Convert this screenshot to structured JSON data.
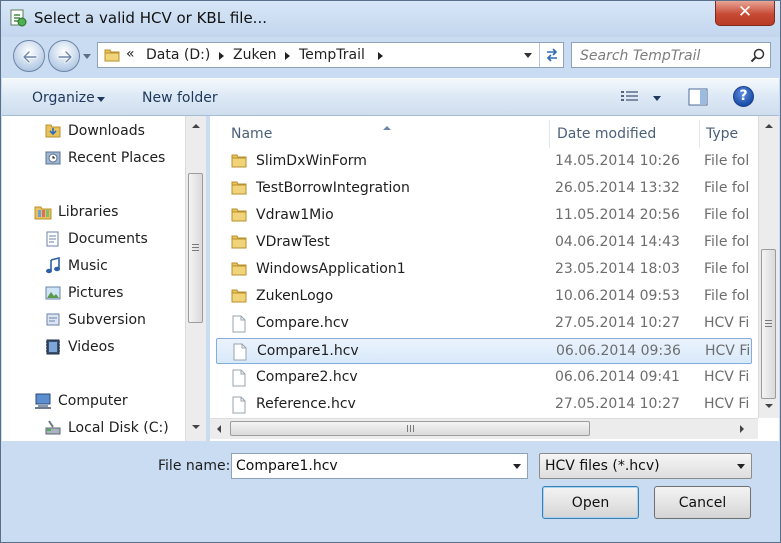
{
  "window": {
    "title": "Select a valid HCV or KBL file..."
  },
  "titlebar": {
    "close_label": "✕"
  },
  "address": {
    "overflow_marker": "«",
    "breadcrumbs": [
      "Data (D:)",
      "Zuken",
      "TempTrail"
    ]
  },
  "search": {
    "placeholder": "Search TempTrail"
  },
  "toolbar": {
    "organize_label": "Organize",
    "new_folder_label": "New folder",
    "help_label": "?"
  },
  "nav_pane": {
    "items": [
      {
        "label": "Downloads",
        "icon": "downloads-folder-icon"
      },
      {
        "label": "Recent Places",
        "icon": "recent-places-icon"
      },
      {
        "label": "Libraries",
        "icon": "libraries-icon"
      },
      {
        "label": "Documents",
        "icon": "documents-icon"
      },
      {
        "label": "Music",
        "icon": "music-icon"
      },
      {
        "label": "Pictures",
        "icon": "pictures-icon"
      },
      {
        "label": "Subversion",
        "icon": "subversion-icon"
      },
      {
        "label": "Videos",
        "icon": "videos-icon"
      },
      {
        "label": "Computer",
        "icon": "computer-icon"
      },
      {
        "label": "Local Disk (C:)",
        "icon": "local-disk-icon"
      }
    ]
  },
  "file_list": {
    "columns": [
      "Name",
      "Date modified",
      "Type"
    ],
    "rows": [
      {
        "name": "SlimDxWinForm",
        "date": "14.05.2014 10:26",
        "type": "File fol",
        "kind": "folder"
      },
      {
        "name": "TestBorrowIntegration",
        "date": "26.05.2014 13:32",
        "type": "File fol",
        "kind": "folder"
      },
      {
        "name": "Vdraw1Mio",
        "date": "11.05.2014 20:56",
        "type": "File fol",
        "kind": "folder"
      },
      {
        "name": "VDrawTest",
        "date": "04.06.2014 14:43",
        "type": "File fol",
        "kind": "folder"
      },
      {
        "name": "WindowsApplication1",
        "date": "23.05.2014 18:03",
        "type": "File fol",
        "kind": "folder"
      },
      {
        "name": "ZukenLogo",
        "date": "10.06.2014 09:53",
        "type": "File fol",
        "kind": "folder"
      },
      {
        "name": "Compare.hcv",
        "date": "27.05.2014 10:27",
        "type": "HCV Fi",
        "kind": "file"
      },
      {
        "name": "Compare1.hcv",
        "date": "06.06.2014 09:36",
        "type": "HCV Fi",
        "kind": "file",
        "selected": true
      },
      {
        "name": "Compare2.hcv",
        "date": "06.06.2014 09:41",
        "type": "HCV Fi",
        "kind": "file"
      },
      {
        "name": "Reference.hcv",
        "date": "27.05.2014 10:27",
        "type": "HCV Fi",
        "kind": "file"
      }
    ]
  },
  "bottom": {
    "file_name_label": "File name:",
    "file_name_value": "Compare1.hcv",
    "filter_value": "HCV files (*.hcv)",
    "open_label": "Open",
    "cancel_label": "Cancel"
  },
  "colors": {
    "window_frame": "#c9dcf1",
    "selection_border": "#84acdd",
    "folder_yellow": "#e8c25a",
    "close_red": "#c74a35"
  }
}
